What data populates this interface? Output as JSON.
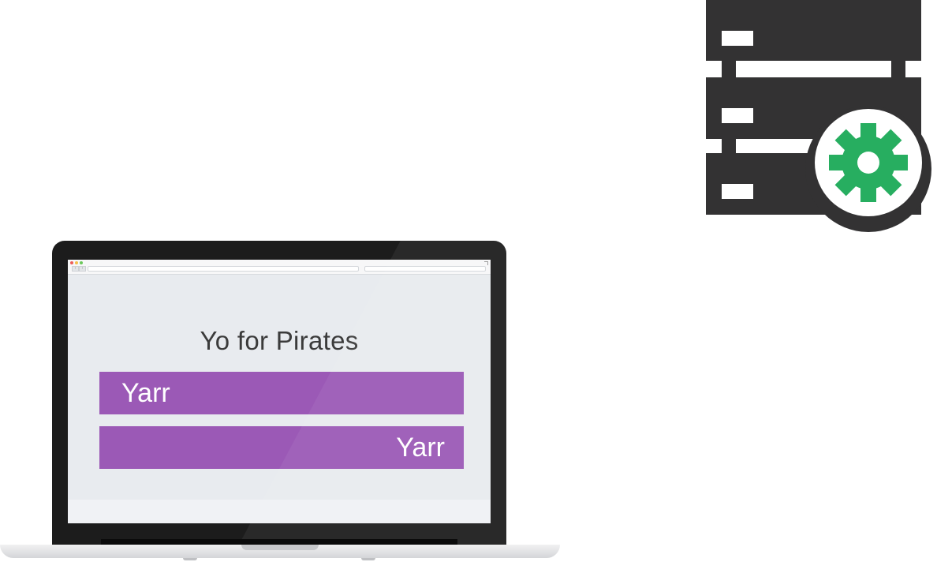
{
  "app": {
    "title": "Yo for Pirates"
  },
  "messages": [
    {
      "text": "Yarr",
      "align": "left"
    },
    {
      "text": "Yarr",
      "align": "right"
    }
  ],
  "browser": {
    "back_glyph": "‹",
    "forward_glyph": "›"
  },
  "icons": {
    "server": "server-stack-icon",
    "gear": "gear-icon"
  },
  "colors": {
    "message_bar": "#9b59b6",
    "gear": "#27ae60",
    "server": "#333233",
    "screen_bg": "#e8ebef"
  }
}
